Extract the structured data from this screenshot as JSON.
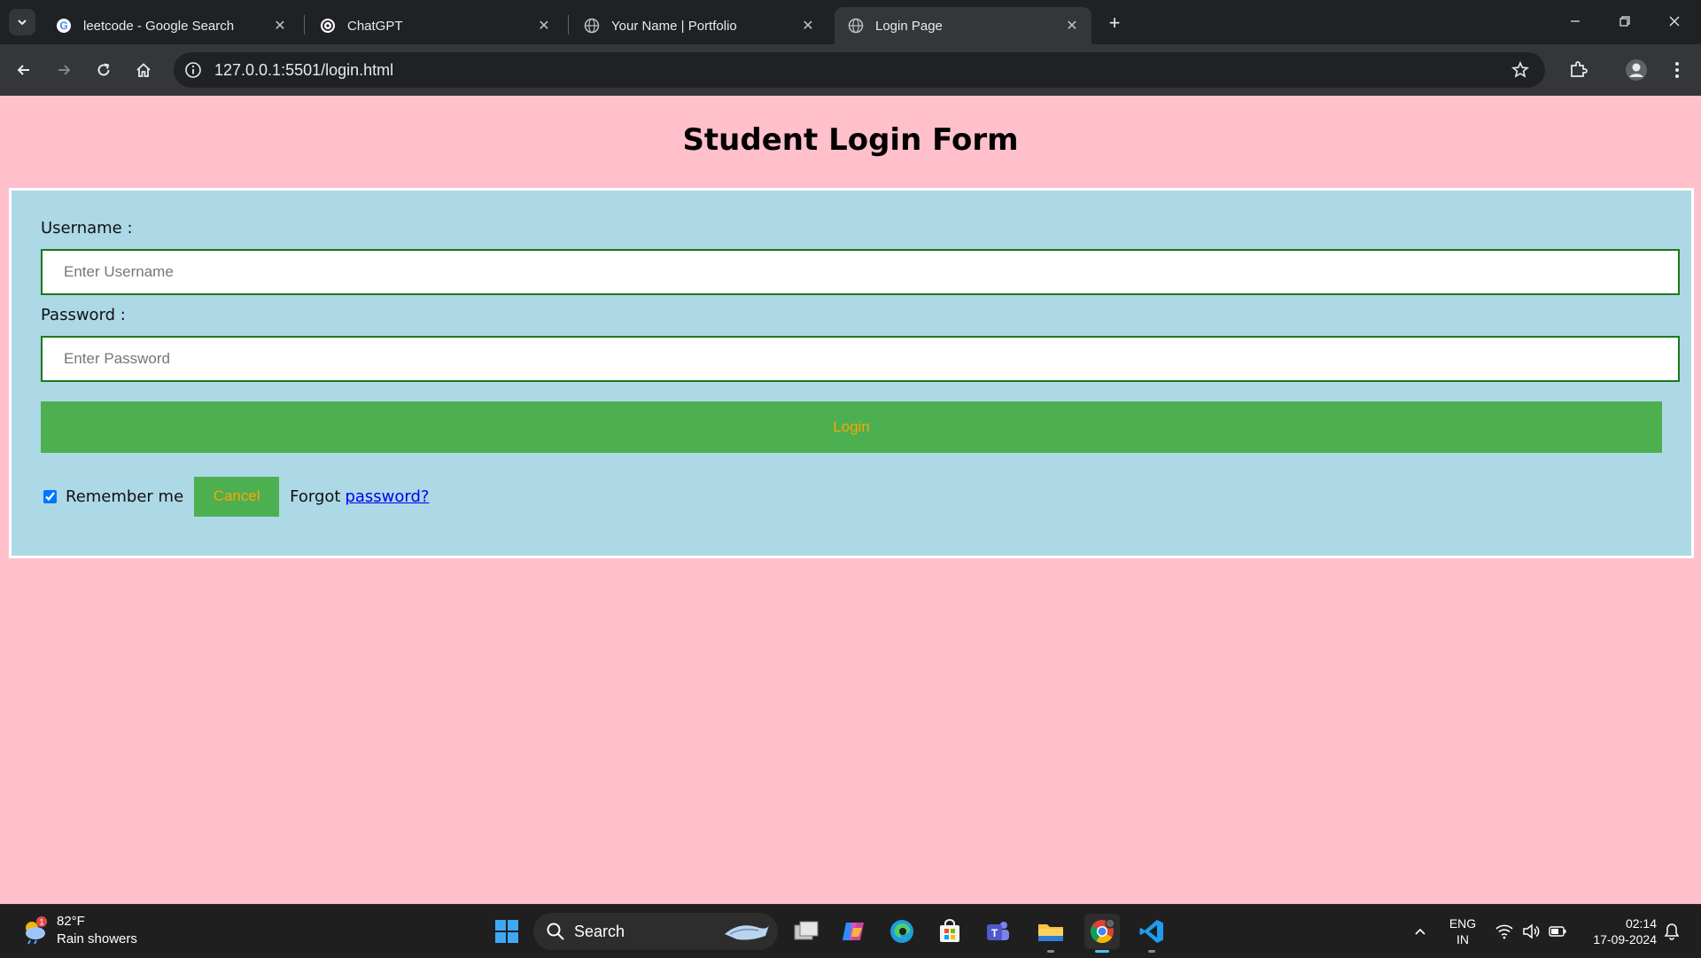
{
  "browser": {
    "tabs": [
      {
        "title": "leetcode - Google Search",
        "favicon": "google-icon"
      },
      {
        "title": "ChatGPT",
        "favicon": "chatgpt-icon"
      },
      {
        "title": "Your Name | Portfolio",
        "favicon": "globe-icon"
      },
      {
        "title": "Login Page",
        "favicon": "globe-icon",
        "active": true
      }
    ],
    "url": "127.0.0.1:5501/login.html"
  },
  "page": {
    "heading": "Student Login Form",
    "username_label": "Username :",
    "username_placeholder": "Enter Username",
    "password_label": "Password :",
    "password_placeholder": "Enter Password",
    "login_label": "Login",
    "remember_label": "Remember me",
    "remember_checked": true,
    "cancel_label": "Cancel",
    "forgot_text": "Forgot",
    "forgot_link": "password?",
    "colors": {
      "background": "#ffc0cb",
      "form": "#add8e6",
      "button": "#4caf50",
      "button_text": "#ffa500"
    }
  },
  "taskbar": {
    "weather_temp": "82°F",
    "weather_condition": "Rain showers",
    "weather_badge": "1",
    "search_label": "Search",
    "lang_line1": "ENG",
    "lang_line2": "IN",
    "time": "02:14",
    "date": "17-09-2024"
  }
}
